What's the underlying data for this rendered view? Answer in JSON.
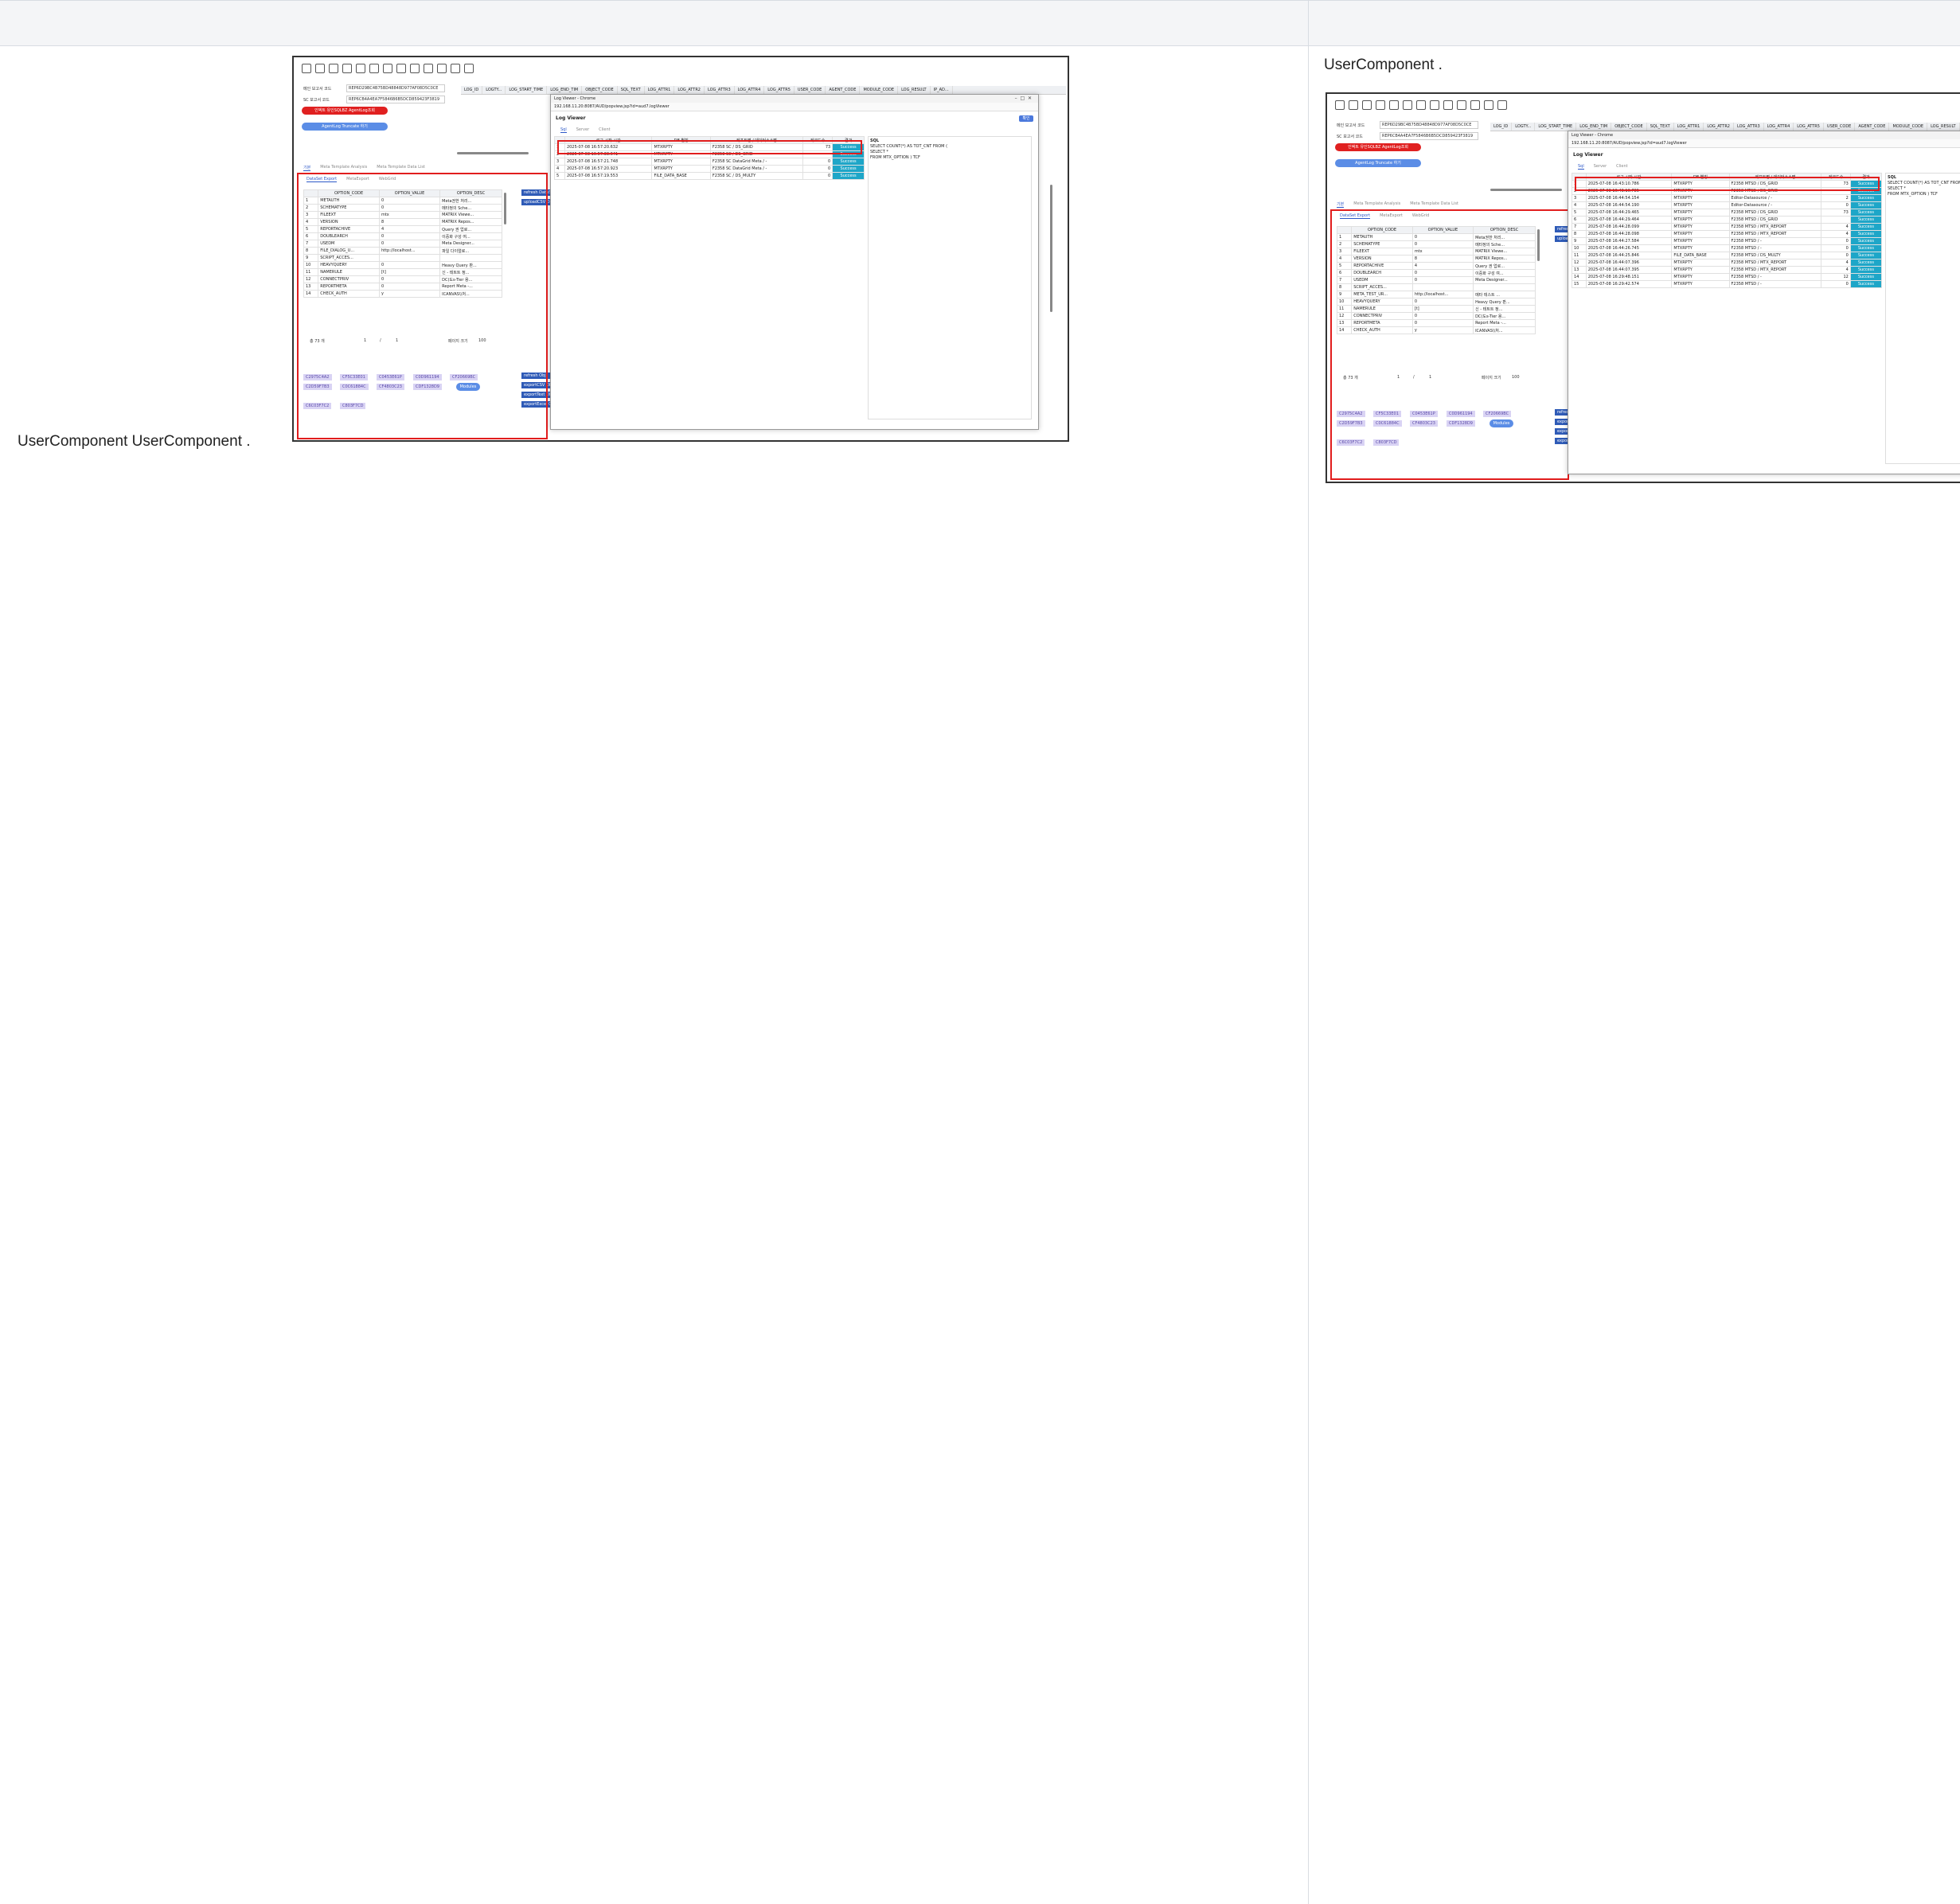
{
  "captions": {
    "left": "UserComponent    UserComponent  .",
    "right": "UserComponent      ."
  },
  "shot": {
    "form": {
      "report_code_label": "메인 보고서 코드",
      "report_code_value": "REP6D29BC4B75BD48848D977AF08D5C0CE",
      "sc_code_label": "SC 보고서 코드",
      "sc_code_value": "REP6CB4A4EA7F5846B6B5DCD859423F3819",
      "red_button": "인덱트 유인SQLBZ AgentLog조회",
      "blue_button": "AgentLog Truncate 하기"
    },
    "grid_columns": [
      "LOG_ID",
      "LOGTY...",
      "LOG_START_TIME",
      "LOG_END_TIM",
      "OBJECT_CODE",
      "SQL_TEXT",
      "LOG_ATTR1",
      "LOG_ATTR2",
      "LOG_ATTR3",
      "LOG_ATTR4",
      "LOG_ATTR5",
      "USER_CODE",
      "AGENT_CODE",
      "MODULE_CODE",
      "LOG_RESULT",
      "IP_AD..."
    ],
    "main_tabs": [
      "기본",
      "Meta Template Analysis",
      "Meta Template Data List"
    ],
    "sub_tabs": [
      "DataSet Export",
      "MetaExport",
      "WebGrid"
    ],
    "option_headers": [
      "",
      "OPTION_CODE",
      "OPTION_VALUE",
      "OPTION_DESC"
    ],
    "option_rows_left": [
      [
        "1",
        "METAUTH",
        "0",
        "Meta권한 처리..."
      ],
      [
        "2",
        "SCHEMATYPE",
        "0",
        "메타정의 Sche..."
      ],
      [
        "3",
        "FILEEXT",
        "mtx",
        "MATRIX Viewe..."
      ],
      [
        "4",
        "VERSION",
        "8",
        "MATRIX Repos..."
      ],
      [
        "5",
        "REPORTACHIVE",
        "4",
        "Query 권 업로..."
      ],
      [
        "6",
        "DOUBLEARCH",
        "0",
        "이중화 구성 여..."
      ],
      [
        "7",
        "USEDM",
        "0",
        "Meta Designer..."
      ],
      [
        "8",
        "FILE_DIALOG_U...",
        "http://localhost...",
        "파일 다이얼로..."
      ],
      [
        "9",
        "SCRIPT_ACCES...",
        "",
        ""
      ],
      [
        "10",
        "HEAVYQUERY",
        "0",
        "Heavy Query 판..."
      ],
      [
        "11",
        "NAMERULE",
        "[t]",
        "신 - 테트트 정..."
      ],
      [
        "12",
        "CONNECTPRIV",
        "0",
        "DC(도s-Tier 용..."
      ],
      [
        "13",
        "REPORTMETA",
        "0",
        "Report Meta -..."
      ],
      [
        "14",
        "CHECK_AUTH",
        "y",
        "ICANVAS\\\\처..."
      ]
    ],
    "option_rows_right": [
      [
        "1",
        "METAUTH",
        "0",
        "Meta권한 처리..."
      ],
      [
        "2",
        "SCHEMATYPE",
        "0",
        "메타정의 Sche..."
      ],
      [
        "3",
        "FILEEXT",
        "mtx",
        "MATRIX Viewe..."
      ],
      [
        "4",
        "VERSION",
        "8",
        "MATRIX Repos..."
      ],
      [
        "5",
        "REPORTACHIVE",
        "4",
        "Query 권 업로..."
      ],
      [
        "6",
        "DOUBLEARCH",
        "0",
        "이중화 구성 여..."
      ],
      [
        "7",
        "USEDM",
        "0",
        "Meta Designer..."
      ],
      [
        "8",
        "SCRIPT_ACCES...",
        "",
        ""
      ],
      [
        "9",
        "META_TEST_UR...",
        "http://localhost...",
        "메타 테스트 ..."
      ],
      [
        "10",
        "HEAVYQUERY",
        "0",
        "Heavy Query 판..."
      ],
      [
        "11",
        "NAMERULE",
        "[t]",
        "신 - 테트트 정..."
      ],
      [
        "12",
        "CONNECTPRIV",
        "0",
        "DC(도s-Tier 용..."
      ],
      [
        "13",
        "REPORTMETA",
        "0",
        "Report Meta -..."
      ],
      [
        "14",
        "CHECK_AUTH",
        "y",
        "ICANVAS\\\\처..."
      ]
    ],
    "paging": {
      "total": "총 73 개",
      "page": "1",
      "sep": "/",
      "pages": "1",
      "size_label": "페이지 크기",
      "size": "100"
    },
    "chips": [
      "C2975C4A2",
      "CF5C33E01",
      "C0453E61P",
      "C0D961194",
      "CF20669BC",
      "C2D59F7B3",
      "C0C61884C",
      "CF4803C23",
      "CDF1328D9",
      "C6C03F7C2",
      "C803F7CD"
    ],
    "chip_blue": "Modules",
    "side_buttons": [
      "refresh DataSet",
      "uploadCSV DataSet",
      "refresh Obj",
      "exportCSV Obj",
      "exportText Obj",
      "exportExcel Obj"
    ]
  },
  "popup": {
    "title": "Log Viewer - Chrome",
    "url": "192.168.11.20:8087/AUD/popview.jsp?id=aud7.logViewer",
    "heading": "Log Viewer",
    "ok": "확인",
    "tabs": [
      "Sql",
      "Server",
      "Client"
    ],
    "headers": [
      "",
      "로그 시작 시간",
      "DB 별칭",
      "레포트명 / 데이터소스명",
      "레코드수",
      "결과"
    ],
    "sql_label": "SQL",
    "sql_text": "SELECT COUNT(*) AS TOT_CNT FROM (\nSELECT *\nFROM MTX_OPTION ) TCF",
    "rows_left": [
      [
        "1",
        "2025-07-08 16:57:20.632",
        "MTXRPTY",
        "F2358 SC / DS_GRID",
        "73",
        "Success"
      ],
      [
        "2",
        "2025-07-08 16:57:38.641",
        "MTXRPTY",
        "F2358 SC / DS_GRID",
        "",
        "Success"
      ],
      [
        "3",
        "2025-07-08 16:57:21.748",
        "MTXRPTY",
        "F2358 SC DataGrid Meta / -",
        "0",
        "Success"
      ],
      [
        "4",
        "2025-07-08 16:57:20.923",
        "MTXRPTY",
        "F2358 SC DataGrid Meta / -",
        "0",
        "Success"
      ],
      [
        "5",
        "2025-07-08 16:57:19.553",
        "FILE_DATA_BASE",
        "F2358 SC / DS_MULTY",
        "0",
        "Success"
      ]
    ],
    "rows_right": [
      [
        "1",
        "2025-07-08 16:43:10.786",
        "MTXRPTY",
        "F2358 MTSD / DS_GRID",
        "73",
        "Success"
      ],
      [
        "2",
        "2025-07-08 16:43:10.785",
        "MTXRPTY",
        "F2358 MTSD / DS_GRID",
        "",
        "Success"
      ],
      [
        "3",
        "2025-07-08 16:44:54.154",
        "MTXRPTY",
        "Editor-Datasource / -",
        "2",
        "Success"
      ],
      [
        "4",
        "2025-07-08 16:44:54.190",
        "MTXRPTY",
        "Editor-Datasource / -",
        "0",
        "Success"
      ],
      [
        "5",
        "2025-07-08 16:44:29.465",
        "MTXRPTY",
        "F2358 MTSD / DS_GRID",
        "73",
        "Success"
      ],
      [
        "6",
        "2025-07-08 16:44:29.464",
        "MTXRPTY",
        "F2358 MTSD / DS_GRID",
        "",
        "Success"
      ],
      [
        "7",
        "2025-07-08 16:44:28.099",
        "MTXRPTY",
        "F2358 MTSD / MTX_REPORT",
        "4",
        "Success"
      ],
      [
        "8",
        "2025-07-08 16:44:28.098",
        "MTXRPTY",
        "F2358 MTSD / MTX_REPORT",
        "4",
        "Success"
      ],
      [
        "9",
        "2025-07-08 16:44:27.584",
        "MTXRPTY",
        "F2358 MTSD / -",
        "0",
        "Success"
      ],
      [
        "10",
        "2025-07-08 16:44:26.745",
        "MTXRPTY",
        "F2358 MTSD / -",
        "0",
        "Success"
      ],
      [
        "11",
        "2025-07-08 16:44:25.846",
        "FILE_DATA_BASE",
        "F2358 MTSD / DS_MULTY",
        "0",
        "Success"
      ],
      [
        "12",
        "2025-07-08 16:44:07.396",
        "MTXRPTY",
        "F2358 MTSD / MTX_REPORT",
        "4",
        "Success"
      ],
      [
        "13",
        "2025-07-08 16:44:07.395",
        "MTXRPTY",
        "F2358 MTSD / MTX_REPORT",
        "4",
        "Success"
      ],
      [
        "14",
        "2025-07-08 16:29:48.151",
        "MTXRPTY",
        "F2358 MTSD / -",
        "12",
        "Success"
      ],
      [
        "15",
        "2025-07-08 16:29:42.574",
        "MTXRPTY",
        "F2358 MTSD / -",
        "0",
        "Success"
      ]
    ]
  }
}
